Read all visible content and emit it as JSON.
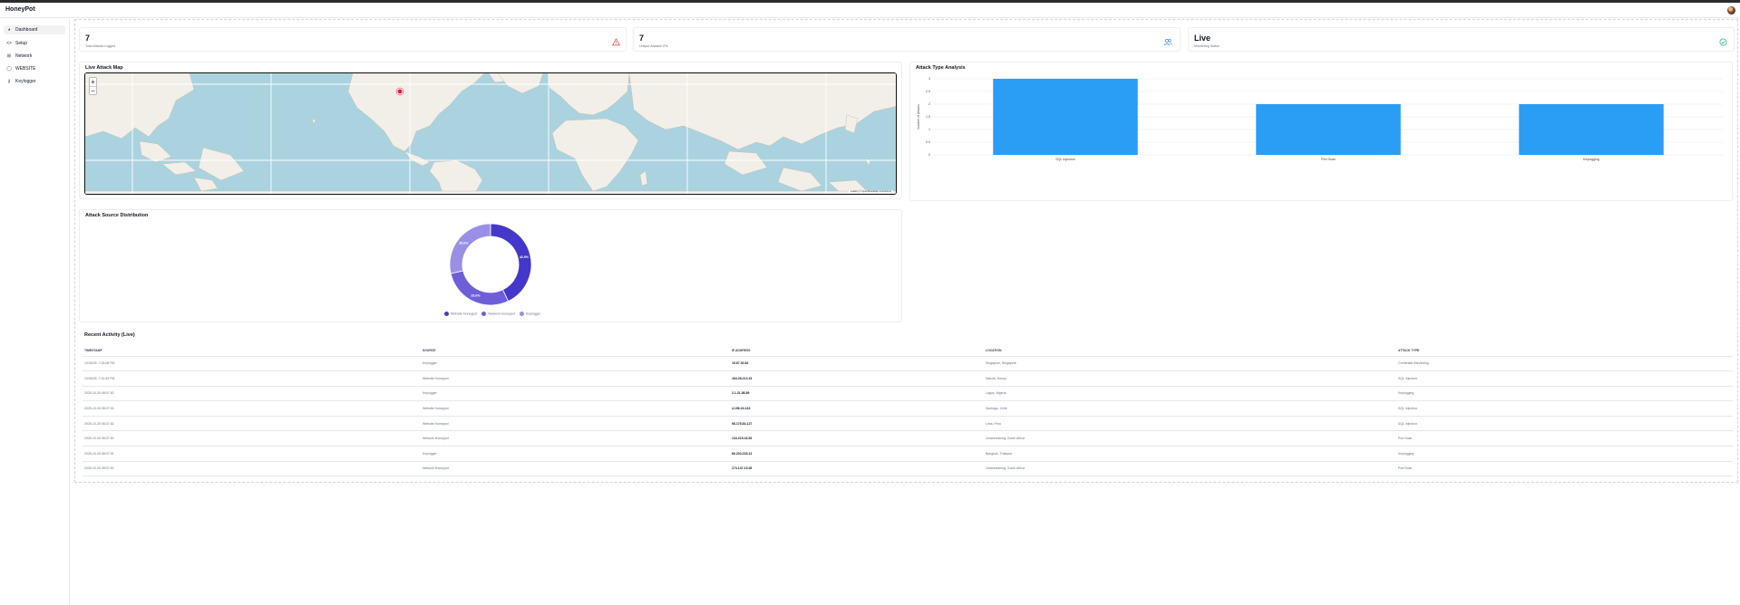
{
  "app": {
    "title": "HoneyPot"
  },
  "sidebar": {
    "items": [
      {
        "label": "Dashboard",
        "icon": "dashboard-icon",
        "active": true
      },
      {
        "label": "Setup",
        "icon": "setup-icon",
        "active": false
      },
      {
        "label": "Network",
        "icon": "network-icon",
        "active": false
      },
      {
        "label": "WEBSITE",
        "icon": "globe-icon",
        "active": false
      },
      {
        "label": "Keylogger",
        "icon": "key-icon",
        "active": false
      }
    ]
  },
  "stats": [
    {
      "value": "7",
      "label": "Total Attacks Logged",
      "icon": "warning-triangle-icon",
      "color": "#ef4444"
    },
    {
      "value": "7",
      "label": "Unique Attacker IPs",
      "icon": "users-icon",
      "color": "#3b82f6"
    },
    {
      "value": "Live",
      "label": "Monitoring Status",
      "icon": "check-circle-icon",
      "color": "#10b981"
    }
  ],
  "map": {
    "title": "Live Attack Map",
    "zoom_in": "+",
    "zoom_out": "−",
    "attribution": "Leaflet | © OpenStreetMap contributors"
  },
  "bar_panel": {
    "title": "Attack Type Analysis"
  },
  "donut_panel": {
    "title": "Attack Source Distribution"
  },
  "chart_data": [
    {
      "type": "bar",
      "title": "Attack Type Analysis",
      "categories": [
        "SQL Injection",
        "Port Scan",
        "Keylogging"
      ],
      "values": [
        3,
        2,
        2
      ],
      "ylabel": "Number of Attacks",
      "ylim": [
        0,
        3
      ],
      "yticks": [
        "0",
        "0.5",
        "1",
        "1.5",
        "2",
        "2.5",
        "3"
      ],
      "color": "#2a9df4",
      "grid": true
    },
    {
      "type": "pie",
      "title": "Attack Source Distribution",
      "labels": [
        "Website Honeypot",
        "Network Honeypot",
        "Keylogger"
      ],
      "values": [
        42.9,
        28.6,
        28.6
      ],
      "value_labels": [
        "42.9%",
        "28.6%",
        "28.6%"
      ],
      "colors": [
        "#4338ca",
        "#6e5fd8",
        "#9a8fe6"
      ],
      "legend": "bottom"
    }
  ],
  "activity": {
    "title": "Recent Activity (Live)",
    "columns": [
      "TIMESTAMP",
      "SOURCE",
      "IP ADDRESS",
      "LOCATION",
      "ATTACK TYPE"
    ],
    "rows": [
      [
        "10/26/25, 7:33:08 PM",
        "Keylogger",
        "15.67.30.62",
        "Singapore, Singapore",
        "Credential Harvesting"
      ],
      [
        "10/26/25, 7:31:53 PM",
        "Website Honeypot",
        "184.28.213.15",
        "Nairobi, Kenya",
        "SQL Injection"
      ],
      [
        "2025-10-26 08:07:30",
        "Keylogger",
        "2.1.21.58.89",
        "Lagos, Nigeria",
        "Keylogging"
      ],
      [
        "2025-10-26 08:07:33",
        "Website Honeypot",
        "4.196.24.133",
        "Santiago, Chile",
        "SQL Injection"
      ],
      [
        "2025-10-26 08:07:30",
        "Website Honeypot",
        "98.175.84.127",
        "Lima, Peru",
        "SQL Injection"
      ],
      [
        "2025-10-26 08:07:30",
        "Network Honeypot",
        "134.215.43.53",
        "Johannesburg, South Africa",
        "Port Scan"
      ],
      [
        "2025-10-26 08:07:32",
        "Keylogger",
        "66.203.233.13",
        "Bangkok, Thailand",
        "Keylogging"
      ],
      [
        "2025-10-26 08:07:30",
        "Network Honeypot",
        "174.147.15.28",
        "Johannesburg, South Africa",
        "Port Scan"
      ]
    ]
  }
}
